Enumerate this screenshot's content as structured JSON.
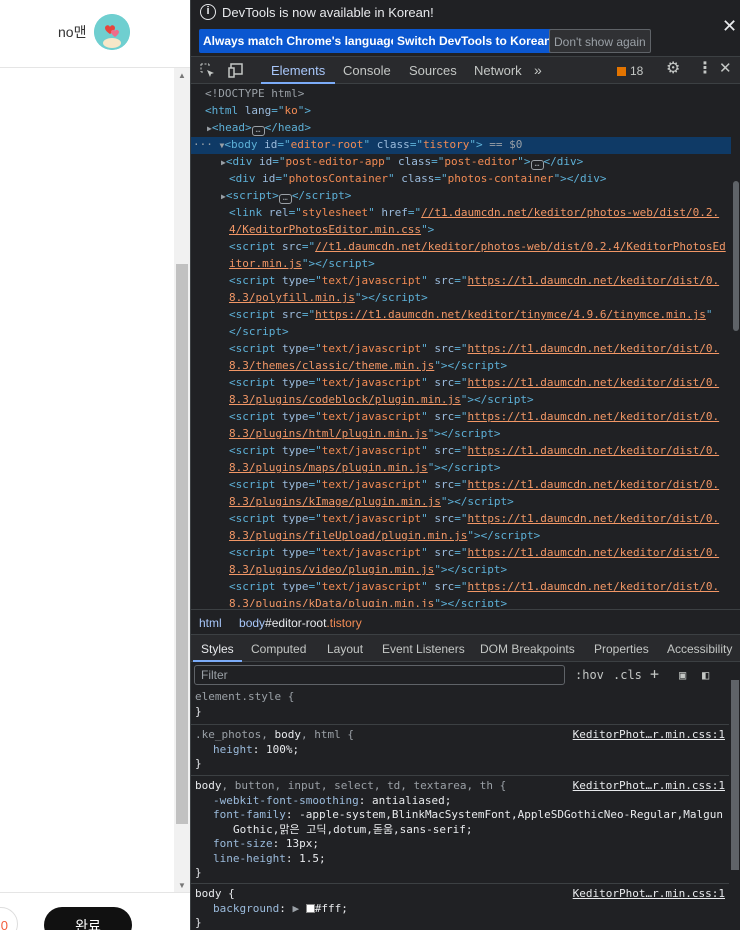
{
  "page": {
    "username": "no맨",
    "count_button": "0",
    "done_button": "완료"
  },
  "devtools": {
    "infobar": {
      "message": "DevTools is now available in Korean!",
      "match_button": "Always match Chrome's language",
      "switch_button": "Switch DevTools to Korean",
      "dismiss_button": "Don't show again"
    },
    "tabs": [
      "Elements",
      "Console",
      "Sources",
      "Network"
    ],
    "issues_count": "18",
    "breadcrumb": {
      "item1": "html",
      "item2_tag": "body",
      "item2_id": "#editor-root",
      "item2_class": ".tistory"
    },
    "style_tabs": [
      "Styles",
      "Computed",
      "Layout",
      "Event Listeners",
      "DOM Breakpoints",
      "Properties",
      "Accessibility"
    ],
    "filter_placeholder": "Filter",
    "filter_tools": {
      "hov": ":hov",
      "cls": ".cls"
    }
  },
  "dom_lines": [
    {
      "t": "doctype",
      "text": "<!DOCTYPE html>"
    },
    {
      "t": "html"
    },
    {
      "t": "head"
    },
    {
      "t": "body"
    },
    {
      "t": "divapp"
    },
    {
      "t": "divphotos"
    },
    {
      "t": "script1"
    }
  ],
  "dom": {
    "doctype": "<!DOCTYPE html>",
    "html_lang": "ko",
    "body_id": "editor-root",
    "body_class": "tistory",
    "body_eq": "== $0",
    "div1_id": "post-editor-app",
    "div1_class": "post-editor",
    "div2_id": "photosContainer",
    "div2_class": "photos-container",
    "link_rel": "stylesheet",
    "link_href_a": "//t1.daumcdn.net/keditor/photos-web/dist/0.2.",
    "link_href_b": "4/KeditorPhotosEditor.min.css",
    "s1_src_a": "//t1.daumcdn.net/keditor/photos-web/dist/0.2.4/KeditorPhotosEd",
    "s1_src_b": "itor.min.js",
    "tjs": "text/javascript",
    "s2_src_a": "https://t1.daumcdn.net/keditor/dist/0.",
    "s2_src_b": "8.3/polyfill.min.js",
    "s3_src": "https://t1.daumcdn.net/keditor/tinymce/4.9.6/tinymce.min.js",
    "s4_src_b": "8.3/themes/classic/theme.min.js",
    "s5_src_b": "8.3/plugins/codeblock/plugin.min.js",
    "s6_src_b": "8.3/plugins/html/plugin.min.js",
    "s7_src_b": "8.3/plugins/maps/plugin.min.js",
    "s8_src_b": "8.3/plugins/kImage/plugin.min.js",
    "s9_src_b": "8.3/plugins/fileUpload/plugin.min.js",
    "s10_src_b": "8.3/plugins/video/plugin.min.js",
    "s11_src_b": "8.3/plugins/kData/plugin.min.js"
  },
  "styles": {
    "r0_sel": "element.style {",
    "r1_sel_dim": ".ke_photos, ",
    "r1_sel_a": "body",
    "r1_sel_dim2": ", html {",
    "r1_src": "KeditorPhot…r.min.css:1",
    "r1_p1_n": "height",
    "r1_p1_v": "100%;",
    "r2_sel_a": "body",
    "r2_sel_dim": ", button, input, select, td, textarea, th {",
    "r2_src": "KeditorPhot…r.min.css:1",
    "r2_p1_n": "-webkit-font-smoothing",
    "r2_p1_v": "antialiased;",
    "r2_p2_n": "font-family",
    "r2_p2_v": "-apple-system,BlinkMacSystemFont,AppleSDGothicNeo-Regular,Malgun",
    "r2_p2_v2": "Gothic,맑은 고딕,dotum,돋움,sans-serif;",
    "r2_p3_n": "font-size",
    "r2_p3_v": "13px;",
    "r2_p4_n": "line-height",
    "r2_p4_v": "1.5;",
    "r3_sel": "body {",
    "r3_src": "KeditorPhot…r.min.css:1",
    "r3_p1_n": "background",
    "r3_p1_v": "#fff;",
    "close": "}"
  },
  "colors": {
    "accent": "#a8c7fa",
    "selection": "#0f3a66",
    "button": "#0b57d0"
  }
}
